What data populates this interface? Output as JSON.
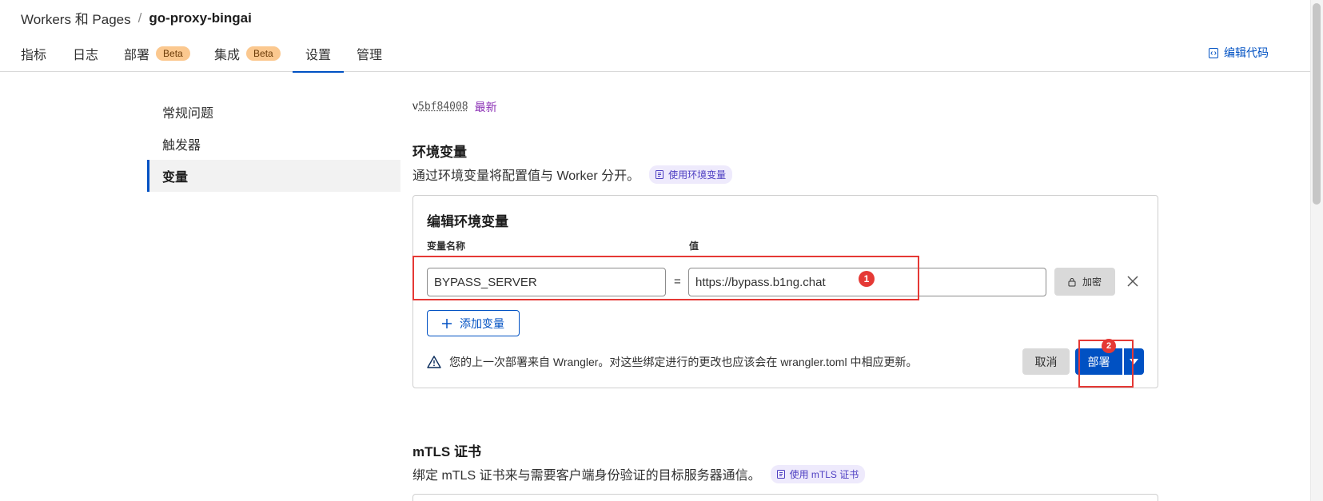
{
  "breadcrumb": {
    "parent": "Workers 和 Pages",
    "separator": "/",
    "current": "go-proxy-bingai"
  },
  "tabs": [
    {
      "label": "指标"
    },
    {
      "label": "日志"
    },
    {
      "label": "部署",
      "badge": "Beta"
    },
    {
      "label": "集成",
      "badge": "Beta"
    },
    {
      "label": "设置",
      "active": true
    },
    {
      "label": "管理"
    }
  ],
  "header_action": {
    "label": "编辑代码",
    "icon": "code-icon"
  },
  "sidenav": {
    "items": [
      {
        "label": "常规问题"
      },
      {
        "label": "触发器"
      },
      {
        "label": "变量",
        "active": true
      }
    ]
  },
  "version": {
    "prefix": "v",
    "id": "5bf84008",
    "tag": "最新"
  },
  "env_section": {
    "title": "环境变量",
    "description": "通过环境变量将配置值与 Worker 分开。",
    "doc_link": "使用环境变量",
    "card": {
      "title": "编辑环境变量",
      "name_label": "变量名称",
      "value_label": "值",
      "variable": {
        "name": "BYPASS_SERVER",
        "equals": "=",
        "value": "https://bypass.b1ng.chat"
      },
      "encrypt_label": "加密",
      "add_label": "添加变量",
      "warning": "您的上一次部署来自 Wrangler。对这些绑定进行的更改也应该会在 wrangler.toml 中相应更新。",
      "cancel_label": "取消",
      "deploy_label": "部署"
    }
  },
  "mtls_section": {
    "title": "mTLS 证书",
    "description": "绑定 mTLS 证书来与需要客户端身份验证的目标服务器通信。",
    "doc_link": "使用 mTLS 证书"
  },
  "annotations": {
    "marker_1": "1",
    "marker_2": "2"
  },
  "colors": {
    "accent": "#0051c3",
    "badge": "#fbc88f",
    "highlight": "#e53935",
    "purple": "#8b2fb5"
  }
}
